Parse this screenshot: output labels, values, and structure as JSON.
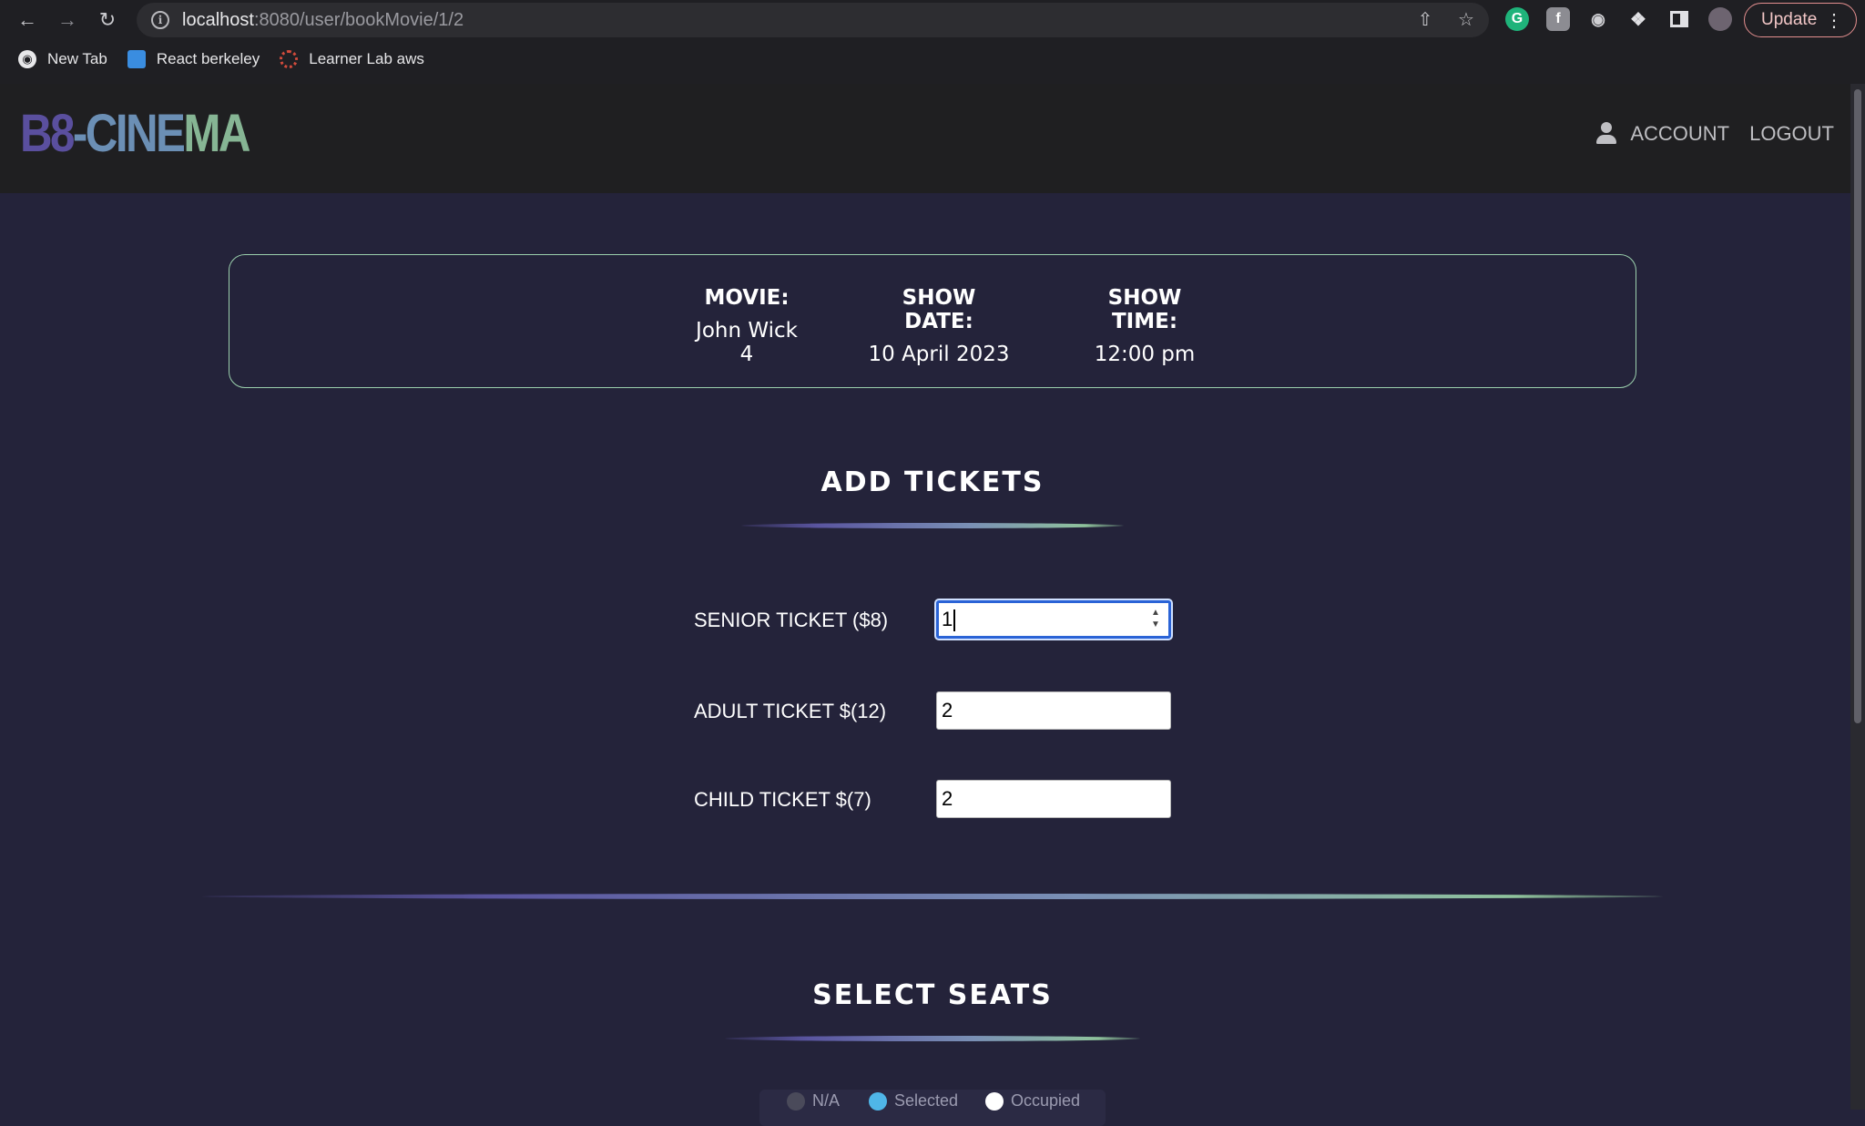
{
  "browser": {
    "url_host": "localhost",
    "url_path": ":8080/user/bookMovie/1/2",
    "update_label": "Update",
    "bookmarks": [
      {
        "label": "New Tab",
        "icon": "globe-icon"
      },
      {
        "label": "React berkeley",
        "icon": "monitor-icon"
      },
      {
        "label": "Learner Lab aws",
        "icon": "lab-icon"
      }
    ]
  },
  "site": {
    "logo_part1": "B8",
    "logo_part2": "-CINE",
    "logo_part3": "MA",
    "nav_account": "ACCOUNT",
    "nav_logout": "LOGOUT"
  },
  "show_info": {
    "movie_label": "MOVIE:",
    "movie_value": "John Wick 4",
    "date_label": "SHOW DATE:",
    "date_value": "10 April 2023",
    "time_label": "SHOW TIME:",
    "time_value": "12:00 pm"
  },
  "tickets": {
    "title": "ADD TICKETS",
    "rows": [
      {
        "label": "SENIOR TICKET ($8)",
        "value": "1"
      },
      {
        "label": "ADULT TICKET $(12)",
        "value": "2"
      },
      {
        "label": "CHILD TICKET $(7)",
        "value": "2"
      }
    ]
  },
  "seats": {
    "title": "SELECT SEATS",
    "legend": [
      {
        "label": "N/A",
        "color": "#4a4a5a"
      },
      {
        "label": "Selected",
        "color": "#4fb6e8"
      },
      {
        "label": "Occupied",
        "color": "#ffffff"
      }
    ]
  },
  "colors": {
    "page_bg": "#24233a",
    "header_bg": "#1f1f21",
    "card_border": "#9bd0ad",
    "focus_ring": "#2a63d6"
  }
}
